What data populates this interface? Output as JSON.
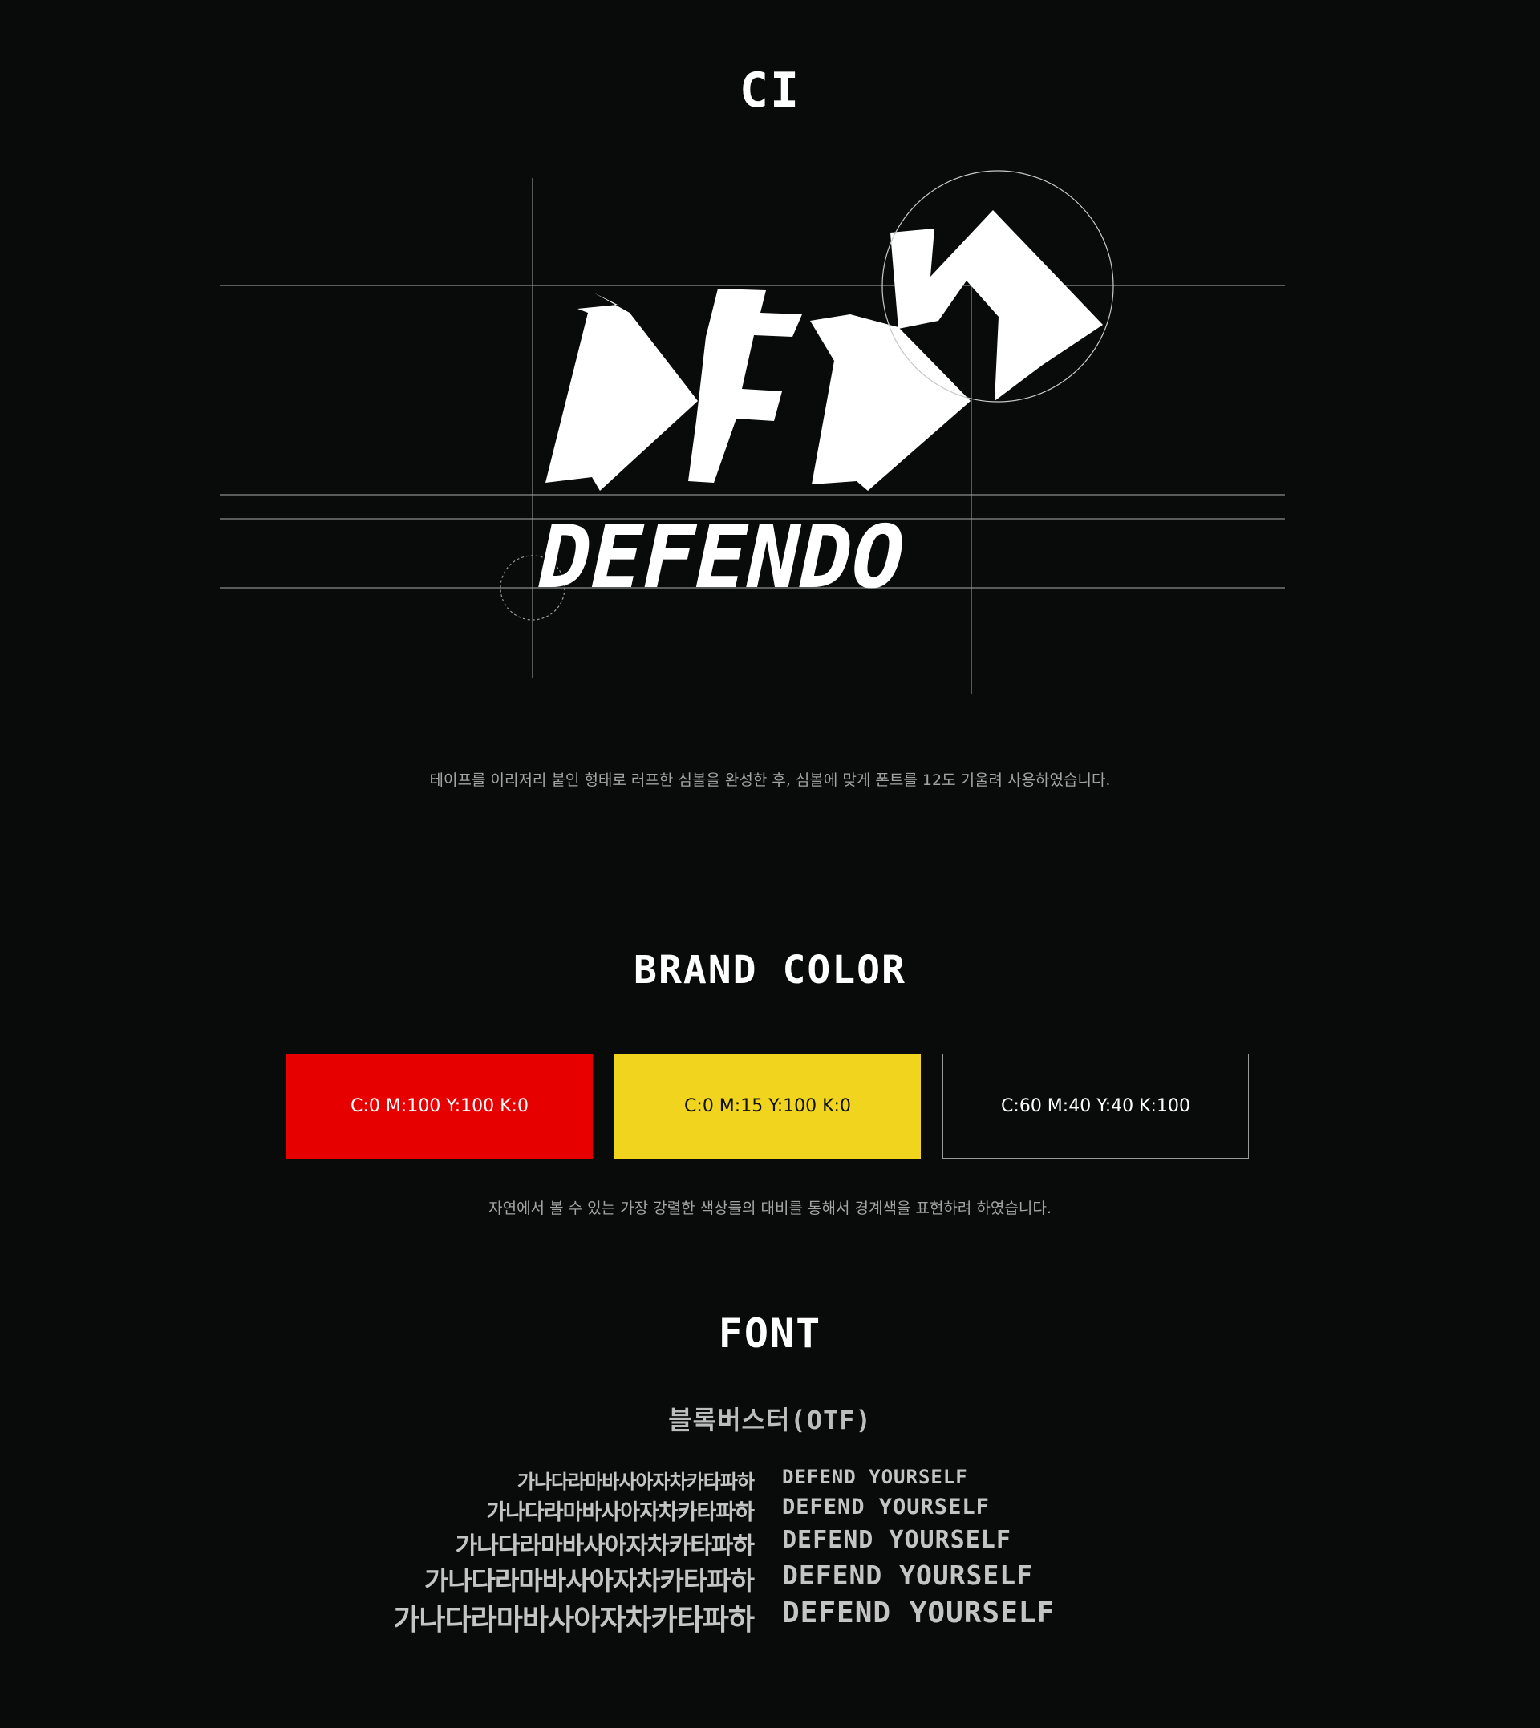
{
  "ci": {
    "title": "CI",
    "wordmark": "DEFENDO",
    "symbol_letters": "DFDN",
    "description": "테이프를 이리저리 붙인 형태로 러프한 심볼을 완성한 후, 심볼에 맞게 폰트를 12도 기울려 사용하였습니다."
  },
  "brand_color": {
    "title": "BRAND COLOR",
    "swatches": [
      {
        "label": "C:0 M:100 Y:100 K:0",
        "hex": "#e60000"
      },
      {
        "label": "C:0 M:15 Y:100 K:0",
        "hex": "#f0d41e"
      },
      {
        "label": "C:60 M:40 Y:40 K:100",
        "hex": "#090a0a"
      }
    ],
    "description": "자연에서 볼 수 있는 가장 강렬한 색상들의 대비를 통해서 경계색을 표현하려 하였습니다."
  },
  "font": {
    "title": "FONT",
    "name": "블록버스터(OTF)",
    "samples_ko": [
      "가나다라마바사아자차카타파하",
      "가나다라마바사아자차카타파하",
      "가나다라마바사아자차카타파하",
      "가나다라마바사아자차카타파하",
      "가나다라마바사아자차카타파하"
    ],
    "samples_en": [
      "DEFEND YOURSELF",
      "DEFEND YOURSELF",
      "DEFEND YOURSELF",
      "DEFEND YOURSELF",
      "DEFEND YOURSELF"
    ]
  }
}
